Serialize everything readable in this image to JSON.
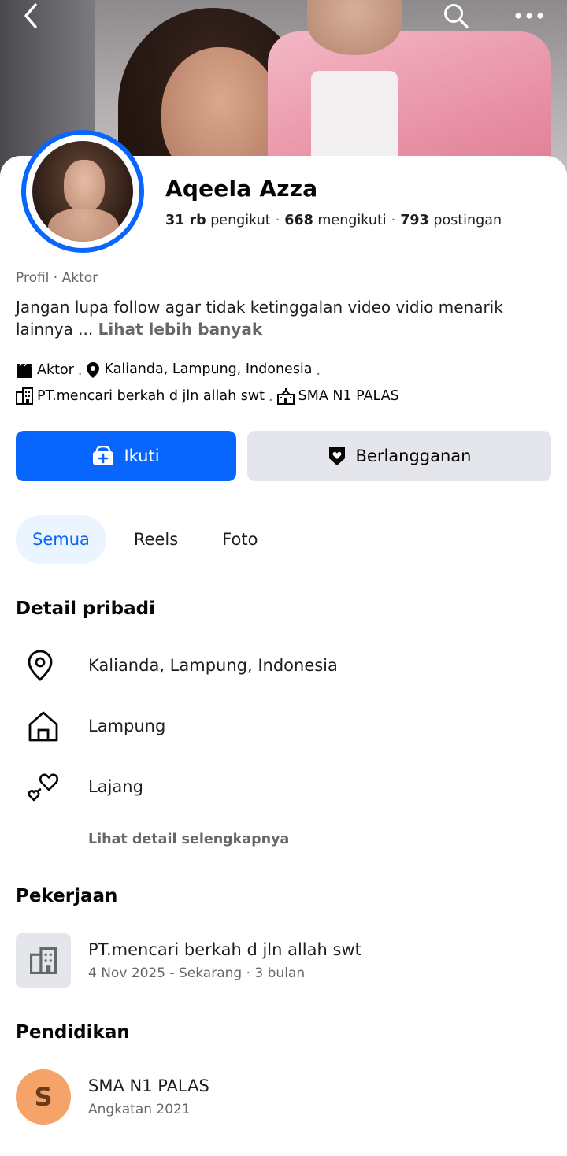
{
  "profile": {
    "name": "Aqeela Azza",
    "followers_count": "31 rb",
    "followers_label": "pengikut",
    "following_count": "668",
    "following_label": "mengikuti",
    "posts_count": "793",
    "posts_label": "postingan",
    "category": "Profil · Aktor",
    "bio": "Jangan lupa follow agar tidak ketinggalan video vidio menarik lainnya ...",
    "bio_more": "Lihat lebih banyak"
  },
  "intro": {
    "role": "Aktor",
    "location": "Kalianda, Lampung, Indonesia",
    "work": "PT.mencari berkah d jln allah swt",
    "school": "SMA N1 PALAS"
  },
  "actions": {
    "follow_label": "Ikuti",
    "subscribe_label": "Berlangganan"
  },
  "tabs": [
    {
      "label": "Semua",
      "active": true
    },
    {
      "label": "Reels",
      "active": false
    },
    {
      "label": "Foto",
      "active": false
    }
  ],
  "personal_details": {
    "title": "Detail pribadi",
    "items": [
      {
        "icon": "location-pin-icon",
        "text": "Kalianda, Lampung, Indonesia"
      },
      {
        "icon": "home-icon",
        "text": "Lampung"
      },
      {
        "icon": "hearts-icon",
        "text": "Lajang"
      }
    ],
    "see_more": "Lihat detail selengkapnya"
  },
  "work": {
    "title": "Pekerjaan",
    "company": "PT.mencari berkah d jln allah swt",
    "period": "4 Nov 2025 - Sekarang · 3 bulan"
  },
  "education": {
    "title": "Pendidikan",
    "initial": "S",
    "school": "SMA N1 PALAS",
    "class_of": "Angkatan 2021"
  },
  "colors": {
    "accent": "#0866ff",
    "secondary_button": "#e4e6eb",
    "muted_text": "#65676b",
    "active_tab_bg": "#ebf5ff",
    "school_avatar": "#f6a36a"
  }
}
